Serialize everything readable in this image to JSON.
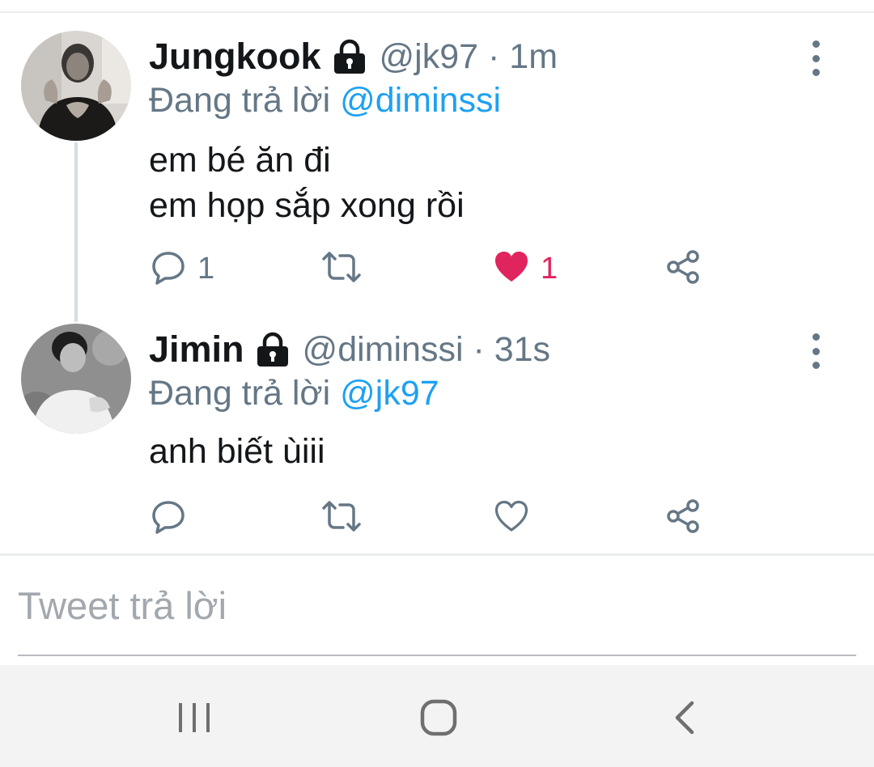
{
  "thread": [
    {
      "avatar_icon": "avatar-jungkook",
      "display_name": "Jungkook",
      "protected_icon": "lock-icon",
      "handle_time": "@jk97 · 1m",
      "reply_prefix": "Đang trả lời",
      "reply_mention": "@diminssi",
      "text_lines": [
        "em bé ăn đi",
        "em họp sắp xong rồi"
      ],
      "actions": {
        "reply_count": "1",
        "retweet_count": "",
        "like_count": "1",
        "liked": true
      }
    },
    {
      "avatar_icon": "avatar-jimin",
      "display_name": "Jimin",
      "protected_icon": "lock-icon",
      "handle_time": "@diminssi · 31s",
      "reply_prefix": "Đang trả lời",
      "reply_mention": "@jk97",
      "text_lines": [
        "anh biết ùiii"
      ],
      "actions": {
        "reply_count": "",
        "retweet_count": "",
        "like_count": "",
        "liked": false
      }
    }
  ],
  "compose": {
    "placeholder": "Tweet trả lời",
    "value": ""
  },
  "navbar": {
    "recent_icon": "recent-apps-icon",
    "home_icon": "home-icon",
    "back_icon": "back-icon"
  },
  "colors": {
    "text": "#14171a",
    "secondary": "#657786",
    "mention": "#1da1f2",
    "like": "#e0245e",
    "divider": "#e9edf0",
    "navbar_bg": "#f3f3f3"
  }
}
